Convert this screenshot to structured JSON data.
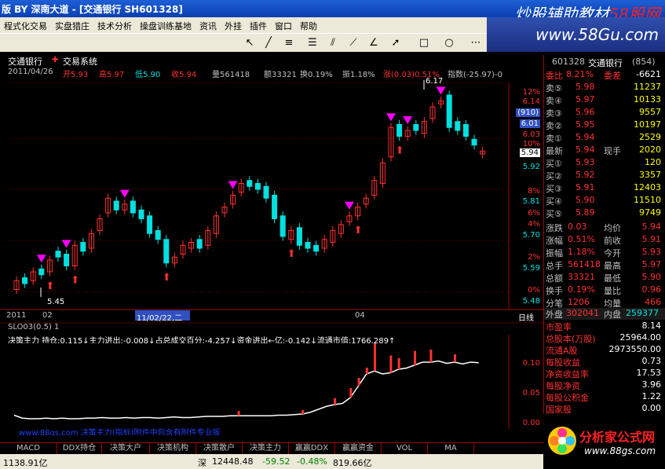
{
  "window": {
    "title": "版 BY 深南大道 - [交通银行 SH601328]",
    "watermark_left": "炒股辅助教材",
    "watermark_brand": "58股网",
    "watermark_url": "www.58Gu.com"
  },
  "menu": [
    "程式化交易",
    "实盘猎庄",
    "技术分析",
    "操盘训练基地",
    "资讯",
    "外挂",
    "插件",
    "窗口",
    "帮助"
  ],
  "main_chart": {
    "title": "交通银行",
    "system": "交易系统",
    "info_date": "2011/04/26",
    "info_open": "开5.93",
    "info_high": "高5.97",
    "info_low": "低5.90",
    "info_close": "收5.94",
    "info_vol": "量561418",
    "info_amount": "额33321",
    "info_turnover": "换0.19%",
    "info_amp": "振1.18%",
    "info_change": "涨(0.03)0.51%",
    "info_index": "指数(-25.97)-0",
    "high_mark": "6.17",
    "low_mark": "5.45",
    "date_labels": [
      "2011",
      "02",
      "11/02/22,二",
      "04"
    ],
    "axis_labels": [
      "12%",
      "6.14",
      "(910)",
      "6.01",
      "6.03",
      "10%",
      "5.94",
      "5.92",
      "8%",
      "5.81",
      "6%",
      "4%",
      "5.70",
      "2%",
      "5.59",
      "0%",
      "5.48"
    ],
    "period": "日线"
  },
  "sub_chart": {
    "title": "SLO03(0.5) 1",
    "legend": "决策主力 持仓:0.115↓主力进出:-0.008↓占总成交百分:-4.257↓资金进出←亿:-0.142↓流通市值:1766.289↑",
    "axis_labels": [
      "0.10",
      "0.05",
      "0.00"
    ],
    "watermark": "www.88gs.com 决策主力(指标)附件中包含有附件专业版"
  },
  "tabs": [
    "MACD",
    "DDX持仓",
    "决策大户",
    "决策机构",
    "决策散户",
    "决策主力",
    "赢赢DDX",
    "赢赢资金",
    "VOL",
    "MA"
  ],
  "status": {
    "left": "1138.91亿",
    "sz": "深",
    "sz_index": "12448.48",
    "sz_change": "-59.52",
    "sz_pct": "-0.48%",
    "sz_amount": "819.66亿"
  },
  "quote": {
    "code": "601328",
    "name": "交通银行",
    "extra": "(854)",
    "weibi_label": "委比",
    "weibi": "8.21%",
    "weicha_label": "委差",
    "weicha": "-6621",
    "asks": [
      {
        "label": "卖⑤",
        "price": "5.98",
        "vol": "11237"
      },
      {
        "label": "卖④",
        "price": "5.97",
        "vol": "10133"
      },
      {
        "label": "卖③",
        "price": "5.96",
        "vol": "9557"
      },
      {
        "label": "卖②",
        "price": "5.95",
        "vol": "10197"
      },
      {
        "label": "卖①",
        "price": "5.94",
        "vol": "2529"
      }
    ],
    "last_label": "最新",
    "last": "5.94",
    "now_label": "现手",
    "now": "2020",
    "bids": [
      {
        "label": "买①",
        "price": "5.93",
        "vol": "120"
      },
      {
        "label": "买②",
        "price": "5.92",
        "vol": "3357"
      },
      {
        "label": "买③",
        "price": "5.91",
        "vol": "12403"
      },
      {
        "label": "买④",
        "price": "5.90",
        "vol": "11510"
      },
      {
        "label": "买⑤",
        "price": "5.89",
        "vol": "9749"
      }
    ],
    "stats": [
      {
        "l1": "涨跌",
        "v1": "0.03",
        "l2": "均价",
        "v2": "5.94"
      },
      {
        "l1": "涨幅",
        "v1": "0.51%",
        "l2": "前收",
        "v2": "5.91"
      },
      {
        "l1": "振幅",
        "v1": "1.18%",
        "l2": "今开",
        "v2": "5.93"
      },
      {
        "l1": "总手",
        "v1": "561418",
        "l2": "最高",
        "v2": "5.97"
      },
      {
        "l1": "总额",
        "v1": "33321",
        "l2": "最低",
        "v2": "5.90"
      },
      {
        "l1": "换手",
        "v1": "0.19%",
        "l2": "量比",
        "v2": "0.96"
      },
      {
        "l1": "分笔",
        "v1": "1206",
        "l2": "均量",
        "v2": "466"
      }
    ],
    "outer_label": "外盘",
    "outer": "302041",
    "inner_label": "内盘",
    "inner": "259377",
    "fund": [
      {
        "k": "市盈率",
        "v": "8.14"
      },
      {
        "k": "总股本(万股)",
        "v": "25964.00"
      },
      {
        "k": "流通A股",
        "v": "2973550.00"
      },
      {
        "k": "每股收益",
        "v": "0.73"
      },
      {
        "k": "净资收益率",
        "v": "17.53"
      },
      {
        "k": "每股净资",
        "v": "3.96"
      },
      {
        "k": "每股公积金",
        "v": "1.22"
      },
      {
        "k": "国家股",
        "v": "0.00"
      }
    ]
  },
  "brand": {
    "name": "分析家公式网",
    "url": "www.88gs.com"
  },
  "colors": {
    "up": "#ff3030",
    "down": "#00e0e0",
    "signal": "#ff00ff",
    "accent": "#a00000"
  }
}
